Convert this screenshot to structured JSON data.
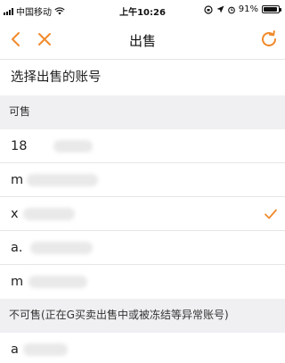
{
  "status_bar": {
    "carrier": "中国移动",
    "time": "上午10:26",
    "battery": "91%",
    "battery_level": 0.91
  },
  "nav": {
    "title": "出售"
  },
  "section_title": "选择出售的账号",
  "sellable": {
    "header": "可售",
    "accounts": [
      {
        "label": "18",
        "selected": false
      },
      {
        "label": "m",
        "selected": false
      },
      {
        "label": "x",
        "selected": true
      },
      {
        "label": "a.",
        "selected": false
      },
      {
        "label": "m",
        "selected": false
      }
    ]
  },
  "unsellable": {
    "header": "不可售(正在G买卖出售中或被冻结等异常账号)",
    "accounts": [
      {
        "label": "a",
        "selected": false
      }
    ]
  },
  "colors": {
    "accent": "#f08a2c",
    "background": "#f0f0f3"
  },
  "icons": {
    "back": "chevron-left-icon",
    "close": "close-icon",
    "refresh": "refresh-icon",
    "check": "check-icon"
  }
}
